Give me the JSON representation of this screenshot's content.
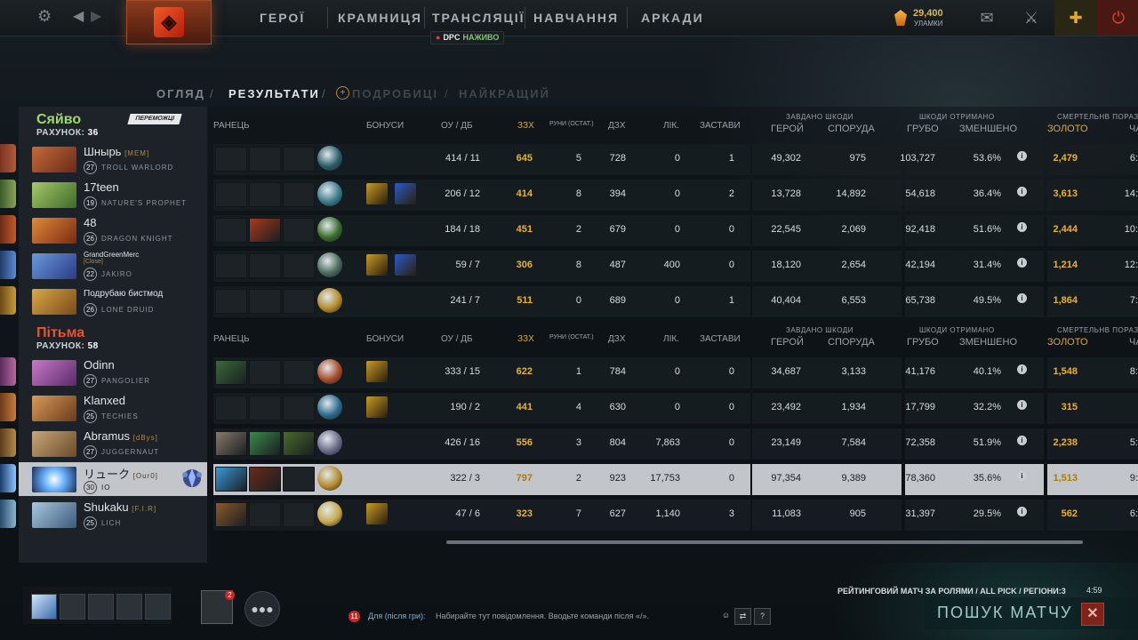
{
  "nav": {
    "items": [
      "ГЕРОЇ",
      "КРАМНИЦЯ",
      "ТРАНСЛЯЦІЇ",
      "НАВЧАННЯ",
      "АРКАДИ"
    ],
    "dpc_badge": "DPC",
    "dpc_live": "НАЖИВО",
    "shards_amount": "29,400",
    "shards_label": "УЛАМКИ"
  },
  "subnav": {
    "items": [
      "ОГЛЯД",
      "РЕЗУЛЬТАТИ",
      "ПОДРОБИЦІ",
      "НАЙКРАЩИЙ"
    ],
    "active": "РЕЗУЛЬТАТИ"
  },
  "teams": {
    "radiant": {
      "name": "Сяйво",
      "score_label": "РАХУНОК:",
      "score": "36",
      "winner_badge": "ПЕРЕМОЖЦІ",
      "color": "#9fd86b"
    },
    "dire": {
      "name": "Пітьма",
      "score_label": "РАХУНОК:",
      "score": "58",
      "color": "#e8542e"
    }
  },
  "players": [
    {
      "name": "Шнырь",
      "tag": "[MEM]",
      "level": "27",
      "hero": "TROLL WARLORD"
    },
    {
      "name": "17teen",
      "tag": "",
      "level": "19",
      "hero": "NATURE'S PROPHET"
    },
    {
      "name": "48",
      "tag": "",
      "level": "26",
      "hero": "DRAGON KNIGHT"
    },
    {
      "name": "GrandGreenMerc",
      "tag": "[Close]",
      "level": "22",
      "hero": "JAKIRO"
    },
    {
      "name": "Подрубаю бистмод",
      "tag": "",
      "level": "26",
      "hero": "LONE DRUID"
    },
    {
      "name": "Odinn",
      "tag": "",
      "level": "27",
      "hero": "PANGOLIER"
    },
    {
      "name": "Klanxed",
      "tag": "",
      "level": "25",
      "hero": "TECHIES"
    },
    {
      "name": "Abramus",
      "tag": "[dBys]",
      "level": "27",
      "hero": "JUGGERNAUT"
    },
    {
      "name": "リューク",
      "tag": "[Our0]",
      "level": "30",
      "hero": "IO"
    },
    {
      "name": "Shukaku",
      "tag": "[F.I.R]",
      "level": "25",
      "hero": "LICH"
    }
  ],
  "headers": {
    "backpack": "РАНЕЦЬ",
    "bonuses": "БОНУСИ",
    "kda": "ОУ  /  ДБ",
    "xpm": "ЗЗХ",
    "runes": "РУНИ (ОСТАТ.)",
    "gpm": "ДЗХ",
    "heal": "ЛІК.",
    "wards": "ЗАСТАВИ",
    "dmg_dealt": "ЗАВДАНО ШКОДИ",
    "hero": "ГЕРОЙ",
    "building": "СПОРУДА",
    "dmg_taken": "ШКОДИ ОТРИМАНО",
    "raw": "ГРУБО",
    "reduced": "ЗМЕНШЕНО",
    "deaths": "СМЕРТЕЛЬНВ ПОРАЗ",
    "gold": "ЗОЛОТО",
    "time": "ЧА"
  },
  "stats": [
    {
      "lh": "414",
      "dn": "11",
      "xpm": "645",
      "runes": "5",
      "gpm": "728",
      "heal": "0",
      "wards": "1",
      "hero_dmg": "49,302",
      "bld_dmg": "975",
      "raw": "103,727",
      "reduced": "53.6%",
      "gold": "2,479",
      "time": "6:"
    },
    {
      "lh": "206",
      "dn": "12",
      "xpm": "414",
      "runes": "8",
      "gpm": "394",
      "heal": "0",
      "wards": "2",
      "hero_dmg": "13,728",
      "bld_dmg": "14,892",
      "raw": "54,618",
      "reduced": "36.4%",
      "gold": "3,613",
      "time": "14:"
    },
    {
      "lh": "184",
      "dn": "18",
      "xpm": "451",
      "runes": "2",
      "gpm": "679",
      "heal": "0",
      "wards": "0",
      "hero_dmg": "22,545",
      "bld_dmg": "2,069",
      "raw": "92,418",
      "reduced": "51.6%",
      "gold": "2,444",
      "time": "10:"
    },
    {
      "lh": "59",
      "dn": "7",
      "xpm": "306",
      "runes": "8",
      "gpm": "487",
      "heal": "400",
      "wards": "0",
      "hero_dmg": "18,120",
      "bld_dmg": "2,654",
      "raw": "42,194",
      "reduced": "31.4%",
      "gold": "1,214",
      "time": "12:"
    },
    {
      "lh": "241",
      "dn": "7",
      "xpm": "511",
      "runes": "0",
      "gpm": "689",
      "heal": "0",
      "wards": "1",
      "hero_dmg": "40,404",
      "bld_dmg": "6,553",
      "raw": "65,738",
      "reduced": "49.5%",
      "gold": "1,864",
      "time": "7:"
    },
    {
      "lh": "333",
      "dn": "15",
      "xpm": "622",
      "runes": "1",
      "gpm": "784",
      "heal": "0",
      "wards": "0",
      "hero_dmg": "34,687",
      "bld_dmg": "3,133",
      "raw": "41,176",
      "reduced": "40.1%",
      "gold": "1,548",
      "time": "8:"
    },
    {
      "lh": "190",
      "dn": "2",
      "xpm": "441",
      "runes": "4",
      "gpm": "630",
      "heal": "0",
      "wards": "0",
      "hero_dmg": "23,492",
      "bld_dmg": "1,934",
      "raw": "17,799",
      "reduced": "32.2%",
      "gold": "315",
      "time": ""
    },
    {
      "lh": "426",
      "dn": "16",
      "xpm": "556",
      "runes": "3",
      "gpm": "804",
      "heal": "7,863",
      "wards": "0",
      "hero_dmg": "23,149",
      "bld_dmg": "7,584",
      "raw": "72,358",
      "reduced": "51.9%",
      "gold": "2,238",
      "time": "5:"
    },
    {
      "lh": "322",
      "dn": "3",
      "xpm": "797",
      "runes": "2",
      "gpm": "923",
      "heal": "17,753",
      "wards": "0",
      "hero_dmg": "97,354",
      "bld_dmg": "9,389",
      "raw": "78,360",
      "reduced": "35.6%",
      "gold": "1,513",
      "time": "9:"
    },
    {
      "lh": "47",
      "dn": "6",
      "xpm": "323",
      "runes": "7",
      "gpm": "627",
      "heal": "1,140",
      "wards": "3",
      "hero_dmg": "11,083",
      "bld_dmg": "905",
      "raw": "31,397",
      "reduced": "29.5%",
      "gold": "562",
      "time": "6:"
    }
  ],
  "bottom": {
    "cards_count": "2",
    "chat_count": "11",
    "chat_prefix": "Для (після гри):",
    "chat_placeholder": "Набирайте тут повідомлення. Вводьте команди після «/».",
    "help_label": "?",
    "queue_mode": "РЕЙТИНГОВИЙ МАТЧ ЗА РОЛЯМИ / ALL PICK / РЕГІОНИ:3",
    "queue_time": "4:59",
    "search_label": "ПОШУК МАТЧУ",
    "cancel_label": "✕"
  }
}
